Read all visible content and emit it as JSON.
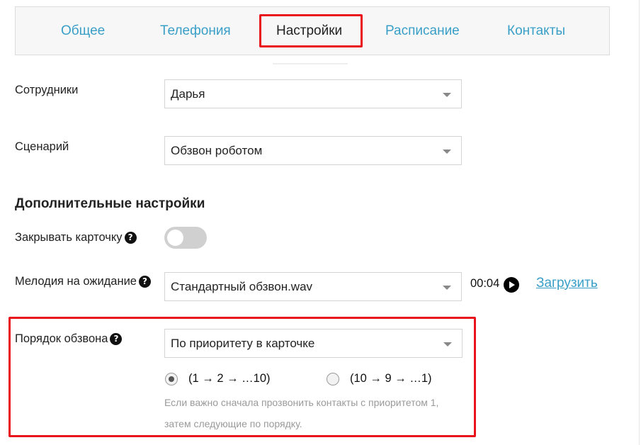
{
  "tabs": [
    {
      "label": "Общее",
      "active": false
    },
    {
      "label": "Телефония",
      "active": false
    },
    {
      "label": "Настройки",
      "active": true
    },
    {
      "label": "Расписание",
      "active": false
    },
    {
      "label": "Контакты",
      "active": false
    }
  ],
  "form": {
    "employees": {
      "label": "Сотрудники",
      "value": "Дарья"
    },
    "scenario": {
      "label": "Сценарий",
      "value": "Обзвон роботом"
    }
  },
  "advanced": {
    "heading": "Дополнительные настройки",
    "close_card": {
      "label": "Закрывать карточку",
      "enabled": false
    },
    "hold_melody": {
      "label": "Мелодия на ожидание",
      "value": "Стандартный обзвон.wav",
      "duration": "00:04",
      "upload_label": "Загрузить"
    },
    "call_order": {
      "label": "Порядок обзвона",
      "value": "По приоритету в карточке",
      "options": [
        {
          "label": "(1 → 2 → …10)",
          "checked": true
        },
        {
          "label": "(10 → 9 → …1)",
          "checked": false
        }
      ],
      "hint_line1": "Если важно сначала прозвонить контакты с приоритетом 1,",
      "hint_line2": "затем следующие по порядку."
    }
  },
  "icons": {
    "help": "question-circle-icon",
    "play": "play-circle-icon",
    "caret": "chevron-down-icon"
  },
  "colors": {
    "accent": "#3a9fc7",
    "highlight": "#e8131b"
  }
}
